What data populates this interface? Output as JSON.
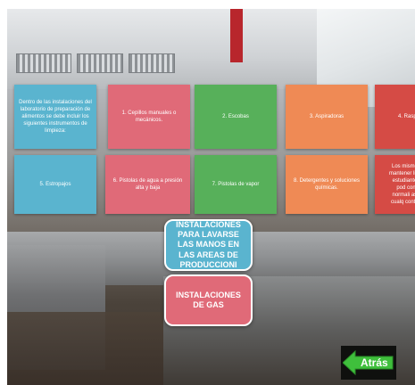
{
  "cards": [
    {
      "text": "Dentro de las instalaciones del laboratorio de preparación de alimentos se debe incluir los siguientes instrumentos de limpieza:",
      "color": "#5ab4cf"
    },
    {
      "text": "1. Cepillos manuales o mecánicos.",
      "color": "#e06a78"
    },
    {
      "text": "2. Escobas",
      "color": "#57b05a"
    },
    {
      "text": "3. Aspiradoras",
      "color": "#ef8a55"
    },
    {
      "text": "4. Rasp",
      "color": "#d54b45"
    },
    {
      "text": "5. Estropajos",
      "color": "#5ab4cf"
    },
    {
      "text": "6. Pistolas de agua a presión alta y baja",
      "color": "#e06a78"
    },
    {
      "text": "7. Pistolas de vapor",
      "color": "#57b05a"
    },
    {
      "text": "8. Detergentes y soluciones químicas.",
      "color": "#ef8a55"
    },
    {
      "text": "Los mismos mantener limp estudiantes pod con normali así, cualq contan",
      "color": "#d54b45"
    }
  ],
  "buttons": {
    "manos": "INSTALACIONES PARA LAVARSE LAS MANOS EN LAS AREAS DE PRODUCCIONI",
    "gas": "INSTALACIONES DE GAS",
    "back": "Atrás"
  }
}
